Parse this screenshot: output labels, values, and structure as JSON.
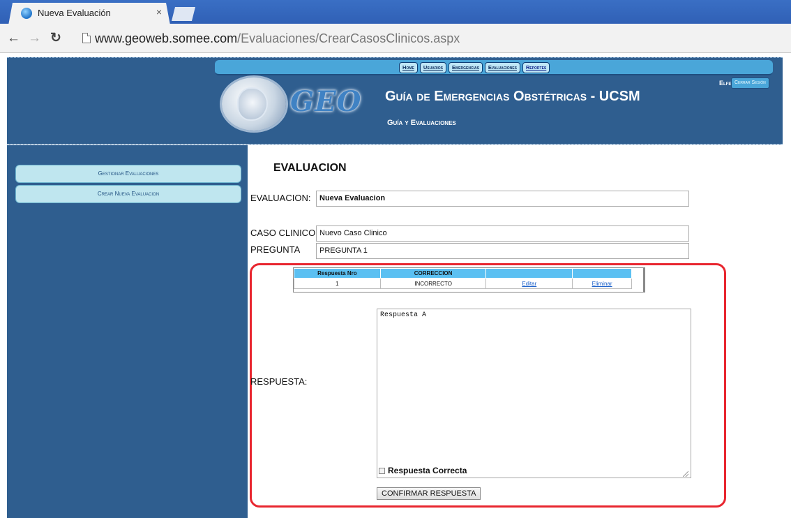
{
  "browser": {
    "tab_title": "Nueva Evaluación",
    "tab_close": "×",
    "url_host": "www.geoweb.somee.com",
    "url_path": "/Evaluaciones/CrearCasosClinicos.aspx"
  },
  "header": {
    "nav": [
      "Home",
      "Usuarios",
      "Emergencias",
      "Evaluaciones",
      "Reportes"
    ],
    "user": "Elfer",
    "logout": "Cerrar Sesión",
    "logo_text": "GEO",
    "title": "Guía de Emergencias Obstétricas - UCSM",
    "subtitle": "Guía y Evaluaciones"
  },
  "sidebar": {
    "items": [
      "Gestionar Evaluaciones",
      "Crear Nueva Evaluacion"
    ]
  },
  "form": {
    "heading": "EVALUACION",
    "evaluacion_label": "EVALUACION:",
    "evaluacion_value": "Nueva Evaluacion",
    "caso_label": "CASO CLINICO",
    "caso_value": "Nuevo Caso Clinico",
    "pregunta_label": "PREGUNTA",
    "pregunta_value": "PREGUNTA 1",
    "respuesta_label": "RESPUESTA:",
    "respuesta_value": "Respuesta A",
    "correct_label": "Respuesta Correcta",
    "confirm_label": "CONFIRMAR RESPUESTA"
  },
  "grid": {
    "headers": [
      "Respuesta Nro",
      "CORRECCION",
      "",
      ""
    ],
    "rows": [
      [
        "1",
        "INCORRECTO",
        "Editar",
        "Eliminar"
      ]
    ]
  },
  "colors": {
    "header_bg": "#2f5e8f",
    "highlight": "#e8262f",
    "grid_header": "#5bc0f2"
  }
}
